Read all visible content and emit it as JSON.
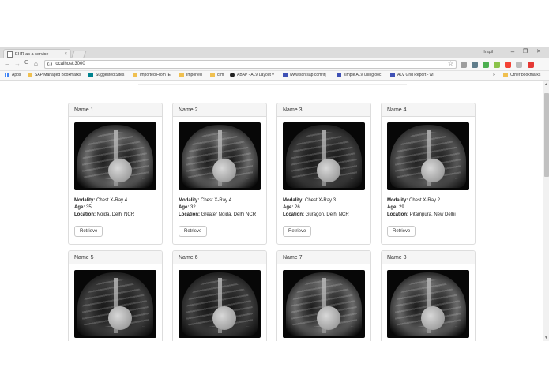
{
  "browser": {
    "tab_title": "EHR as a service",
    "tab_close": "×",
    "user_label": "Ilrapil",
    "address": "localhost:3000",
    "window_controls": {
      "minimize": "–",
      "maximize": "❐",
      "close": "✕"
    },
    "nav": {
      "back": "←",
      "forward": "→",
      "reload": "C",
      "home": "⌂"
    },
    "info_icon": "i",
    "star_icon": "☆",
    "bookmarks": [
      {
        "label": "Apps",
        "icon": "apps-grid"
      },
      {
        "label": "SAP Managed Bookmarks",
        "icon": "folder"
      },
      {
        "label": "Suggested Sites",
        "icon": "b-icon"
      },
      {
        "label": "Imported From IE",
        "icon": "folder"
      },
      {
        "label": "Imported",
        "icon": "folder"
      },
      {
        "label": "crm",
        "icon": "folder"
      },
      {
        "label": "ABAP - ALV Layout v",
        "icon": "circle-icon"
      },
      {
        "label": "www.sdn.sap.com/irj",
        "icon": "lines-icon"
      },
      {
        "label": "simple ALV using ooc",
        "icon": "lines-icon"
      },
      {
        "label": "ALV Grid Report - wi",
        "icon": "lines-icon"
      }
    ],
    "bookmarks_more": "»",
    "other_bookmarks": "Other bookmarks",
    "extension_colors": [
      "#9e9e9e",
      "#607d8b",
      "#4caf50",
      "#8bc34a",
      "#f44336",
      "#bdbdbd",
      "#e53935"
    ],
    "scroll_up": "▲",
    "scroll_down": "▼"
  },
  "labels": {
    "modality": "Modality:",
    "age": "Age:",
    "location": "Location:",
    "retrieve": "Retrieve"
  },
  "cards": [
    {
      "name": "Name 1",
      "modality": "Chest X-Ray 4",
      "age": "35",
      "location": "Noida, Delhi NCR"
    },
    {
      "name": "Name 2",
      "modality": "Chest X-Ray 4",
      "age": "32",
      "location": "Greater Noida, Delhi NCR"
    },
    {
      "name": "Name 3",
      "modality": "Chest X-Ray 3",
      "age": "26",
      "location": "Guragon, Delhi NCR"
    },
    {
      "name": "Name 4",
      "modality": "Chest X-Ray 2",
      "age": "29",
      "location": "Pitampura, New Delhi"
    },
    {
      "name": "Name 5"
    },
    {
      "name": "Name 6"
    },
    {
      "name": "Name 7"
    },
    {
      "name": "Name 8"
    }
  ]
}
